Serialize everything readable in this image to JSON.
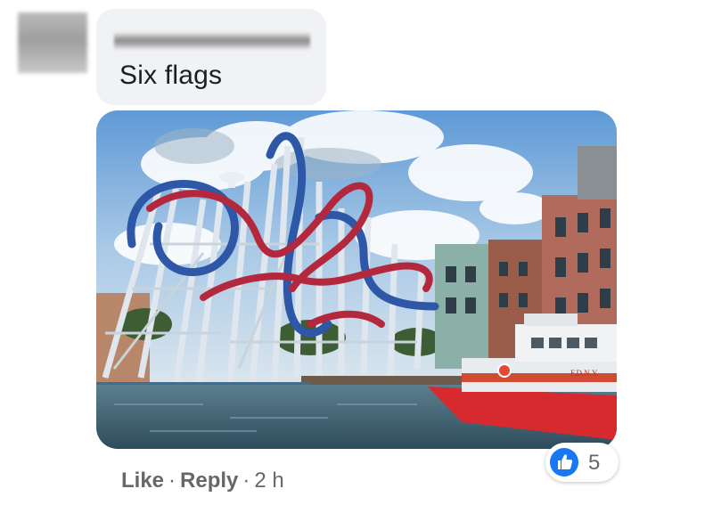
{
  "comment": {
    "text": "Six flags"
  },
  "reactions": {
    "icon": "like-thumb-icon",
    "color": "#1877f2",
    "count": "5"
  },
  "actions": {
    "like_label": "Like",
    "separator": "·",
    "reply_label": "Reply",
    "time": "2 h"
  },
  "image": {
    "boat_label": "F.D.N.Y."
  }
}
